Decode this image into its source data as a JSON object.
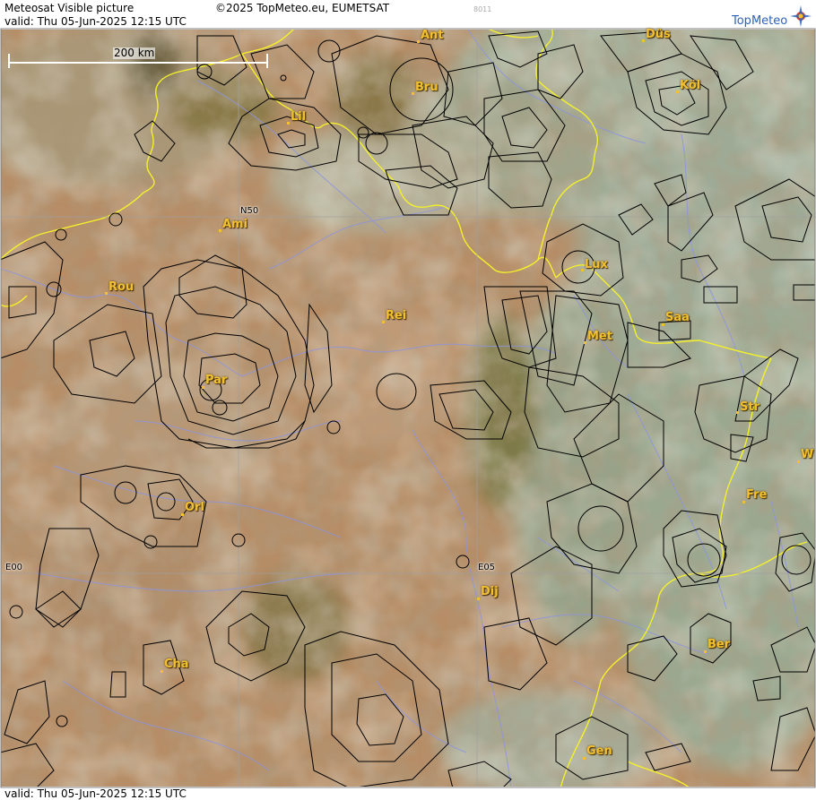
{
  "header": {
    "title": "Meteosat Visible picture",
    "valid": "valid:  Thu  05-Jun-2025  12:15 UTC",
    "copyright": "©2025 TopMeteo.eu, EUMETSAT",
    "code": "8011",
    "logo": "TopMeteo"
  },
  "footer": {
    "valid": "valid:  Thu  05-Jun-2025  12:15 UTC"
  },
  "scale_bar": {
    "label": "200 km"
  },
  "grid_labels": {
    "n50": "N50",
    "e00": "E00",
    "e05": "E05"
  },
  "cities": [
    {
      "name": "Ant"
    },
    {
      "name": "Düs"
    },
    {
      "name": "Bru"
    },
    {
      "name": "Köl"
    },
    {
      "name": "Lil"
    },
    {
      "name": "Ami"
    },
    {
      "name": "Lux"
    },
    {
      "name": "Rou"
    },
    {
      "name": "Rei"
    },
    {
      "name": "Saa"
    },
    {
      "name": "Met"
    },
    {
      "name": "Par"
    },
    {
      "name": "Str"
    },
    {
      "name": "W"
    },
    {
      "name": "Fre"
    },
    {
      "name": "Orl"
    },
    {
      "name": "Dij"
    },
    {
      "name": "Ber"
    },
    {
      "name": "Cha"
    },
    {
      "name": "Gen"
    }
  ],
  "colors": {
    "border": "#f4f02a",
    "river": "#8c94e0",
    "airspace": "#000000",
    "city": "#f0c030",
    "land_warm": "#b08a62",
    "land_green": "#8ea085",
    "cloud": "#c4c8b0"
  }
}
